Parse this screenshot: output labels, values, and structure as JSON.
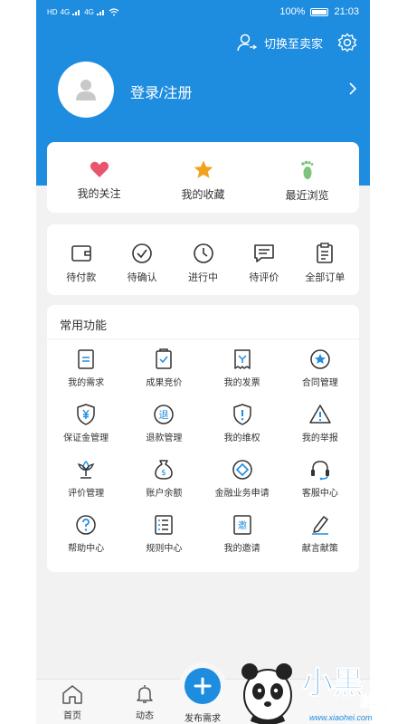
{
  "status_bar": {
    "left_indicators": [
      "HD",
      "4G",
      "4G"
    ],
    "battery": "100%",
    "time": "21:03"
  },
  "header": {
    "switch_label": "切换至卖家",
    "login_label": "登录/注册"
  },
  "quick_links": [
    {
      "icon": "heart-icon",
      "label": "我的关注",
      "color": "#e8556d"
    },
    {
      "icon": "star-icon",
      "label": "我的收藏",
      "color": "#f0a21c"
    },
    {
      "icon": "footprint-icon",
      "label": "最近浏览",
      "color": "#7cc47a"
    }
  ],
  "orders": [
    {
      "icon": "wallet-icon",
      "label": "待付款"
    },
    {
      "icon": "check-circle-icon",
      "label": "待确认"
    },
    {
      "icon": "clock-icon",
      "label": "进行中"
    },
    {
      "icon": "comment-icon",
      "label": "待评价"
    },
    {
      "icon": "clipboard-icon",
      "label": "全部订单"
    }
  ],
  "functions": {
    "title": "常用功能",
    "items": [
      {
        "icon": "document-icon",
        "label": "我的需求"
      },
      {
        "icon": "checklist-icon",
        "label": "成果竞价"
      },
      {
        "icon": "receipt-icon",
        "label": "我的发票"
      },
      {
        "icon": "contract-star-icon",
        "label": "合同管理"
      },
      {
        "icon": "yen-shield-icon",
        "label": "保证金管理"
      },
      {
        "icon": "refund-icon",
        "label": "退款管理"
      },
      {
        "icon": "alert-shield-icon",
        "label": "我的维权"
      },
      {
        "icon": "warning-triangle-icon",
        "label": "我的举报"
      },
      {
        "icon": "flower-icon",
        "label": "评价管理"
      },
      {
        "icon": "money-bag-icon",
        "label": "账户余额"
      },
      {
        "icon": "diamond-icon",
        "label": "金融业务申请"
      },
      {
        "icon": "headset-icon",
        "label": "客服中心"
      },
      {
        "icon": "help-circle-icon",
        "label": "帮助中心"
      },
      {
        "icon": "list-icon",
        "label": "规则中心"
      },
      {
        "icon": "invite-icon",
        "label": "我的邀请"
      },
      {
        "icon": "pen-icon",
        "label": "献言献策"
      }
    ]
  },
  "tabbar": {
    "home": "首页",
    "activity": "动态",
    "publish": "发布需求"
  },
  "watermark": {
    "logo_text": "小黑游戏",
    "url": "www.xiaohei.com"
  },
  "colors": {
    "primary": "#1e8de0",
    "icon_stroke": "#333333",
    "accent_icon": "#1e8de0"
  }
}
